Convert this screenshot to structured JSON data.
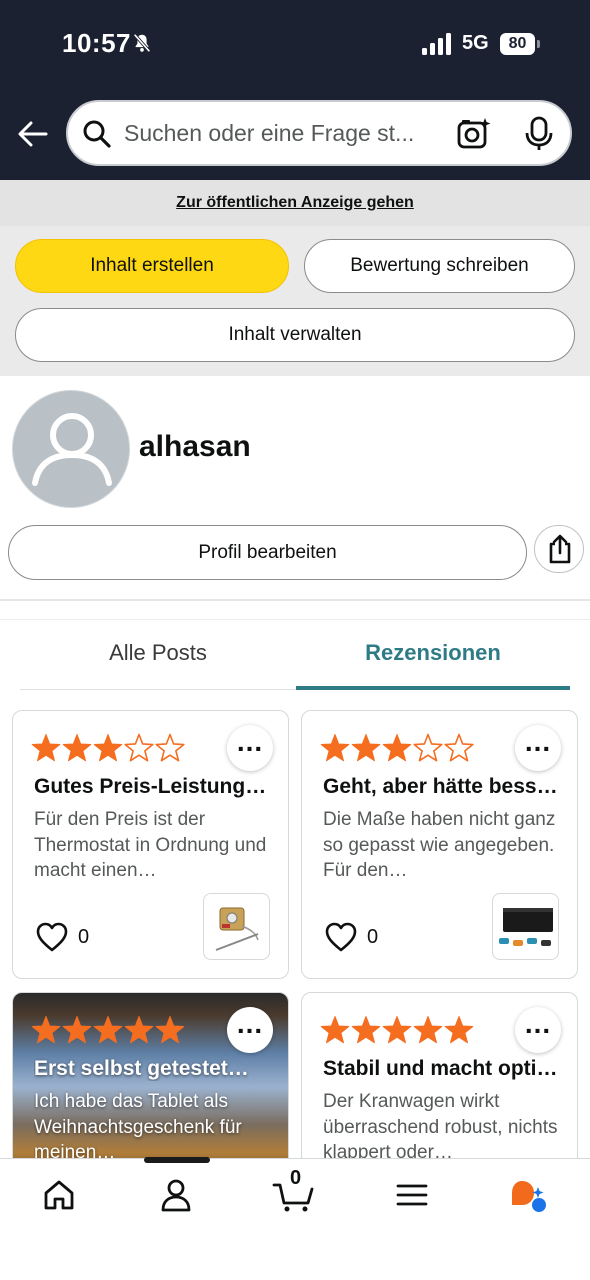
{
  "status_bar": {
    "time": "10:57",
    "network": "5G",
    "battery": "80"
  },
  "search": {
    "placeholder": "Suchen oder eine Frage st..."
  },
  "public_link": "Zur öffentlichen Anzeige gehen",
  "buttons": {
    "create": "Inhalt erstellen",
    "review": "Bewertung schreiben",
    "manage": "Inhalt verwalten",
    "edit_profile": "Profil bearbeiten"
  },
  "profile": {
    "username": "alhasan"
  },
  "tabs": [
    {
      "label": "Alle Posts",
      "active": false
    },
    {
      "label": "Rezensionen",
      "active": true
    }
  ],
  "colors": {
    "header": "#1b2130",
    "accent_yellow": "#ffd814",
    "star": "#f56d1f",
    "tab_active": "#2f7b85"
  },
  "reviews": [
    {
      "rating": 3,
      "title": "Gutes Preis-Leistungsverhältnis",
      "text": "Für den Preis ist der Thermostat in Ordnung und macht einen…",
      "likes": "0",
      "thumb_icon": "thermostat-product-image"
    },
    {
      "rating": 3,
      "title": "Geht, aber hätte besser sein können",
      "text": "Die Maße haben nicht ganz so gepasst wie angegeben. Für den…",
      "likes": "0",
      "thumb_icon": "amplifier-product-image"
    },
    {
      "rating": 5,
      "title": "Erst selbst getestet…",
      "text": "Ich habe das Tablet als Weihnachtsgeschenk für meinen…",
      "likes": "",
      "thumb_icon": ""
    },
    {
      "rating": 5,
      "title": "Stabil und macht optisch was her",
      "text": "Der Kranwagen wirkt überraschend robust, nichts klappert oder…",
      "likes": "",
      "thumb_icon": ""
    }
  ],
  "bottom_nav": {
    "items": [
      "home-icon",
      "account-icon",
      "cart-icon",
      "menu-icon",
      "rufus-ai-icon"
    ],
    "cart_count": "0"
  }
}
